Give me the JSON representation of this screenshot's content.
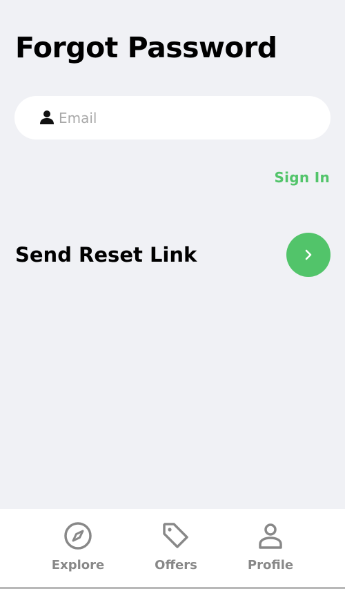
{
  "header": {
    "title": "Forgot Password"
  },
  "form": {
    "email_placeholder": "Email",
    "email_value": "",
    "email_icon": "person-icon",
    "sign_in_label": "Sign In",
    "send_label": "Send Reset Link",
    "send_icon": "chevron-right-icon"
  },
  "colors": {
    "accent": "#52c46a",
    "background": "#f0f1f5",
    "nav_text": "#888888"
  },
  "bottom_nav": {
    "items": [
      {
        "label": "Explore",
        "icon": "compass-icon"
      },
      {
        "label": "Offers",
        "icon": "tag-icon"
      },
      {
        "label": "Profile",
        "icon": "profile-icon"
      }
    ]
  }
}
